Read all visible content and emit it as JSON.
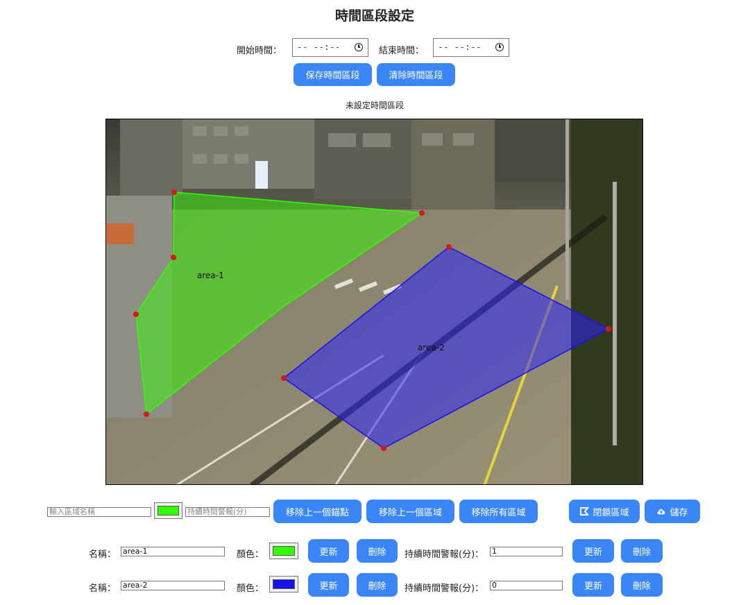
{
  "page": {
    "title": "時間區段設定"
  },
  "time_range": {
    "start_label": "開始時間：",
    "end_label": "結束時間：",
    "start_value": "-- --:--",
    "end_value": "-- --:--",
    "save_label": "保存時間區段",
    "clear_label": "清除時間區段",
    "status": "未設定時間區段"
  },
  "canvas": {
    "areas": [
      {
        "name": "area-1",
        "color": "#33ff00"
      },
      {
        "name": "area-2",
        "color": "#1a10e8"
      }
    ]
  },
  "toolbar": {
    "area_name_placeholder": "輸入區域名稱",
    "new_color": "#33ff00",
    "duration_placeholder": "持續時間警報(分)",
    "remove_last_point": "移除上一個錨點",
    "remove_last_area": "移除上一個區域",
    "remove_all_areas": "移除所有區域",
    "close_area": "閉鎖區域",
    "save": "儲存"
  },
  "area_rows": {
    "labels": {
      "name": "名稱：",
      "color": "顏色：",
      "update": "更新",
      "delete": "刪除",
      "duration": "持續時間警報(分)："
    },
    "rows": [
      {
        "name": "area-1",
        "color": "#33ff00",
        "duration": "1"
      },
      {
        "name": "area-2",
        "color": "#1a10e8",
        "duration": "0"
      }
    ]
  }
}
